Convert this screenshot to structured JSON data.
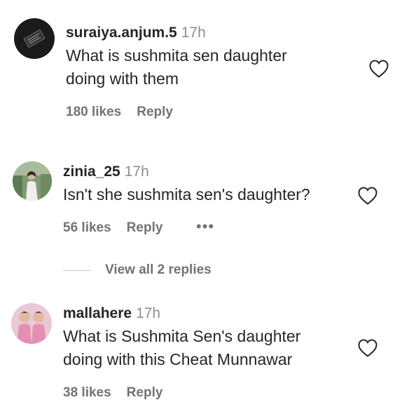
{
  "comments": [
    {
      "username": "suraiya.anjum.5",
      "time": "17h",
      "text_lines": [
        "What is sushmita sen daughter",
        "doing with them"
      ],
      "likes": "180 likes",
      "reply": "Reply",
      "avatar_icon": "dark-tile-avatar"
    },
    {
      "username": "zinia_25",
      "time": "17h",
      "text_lines": [
        "Isn't she sushmita sen's daughter?"
      ],
      "likes": "56 likes",
      "reply": "Reply",
      "more": "•••",
      "avatar_icon": "person-photo-avatar"
    },
    {
      "username": "mallahere",
      "time": "17h",
      "text_lines": [
        "What is Sushmita Sen's daughter",
        "doing with this Cheat Munnawar"
      ],
      "likes": "38 likes",
      "reply": "Reply",
      "avatar_icon": "two-girls-photo-avatar"
    }
  ],
  "view_replies": "View all 2 replies",
  "colors": {
    "text": "#262626",
    "secondary": "#737373",
    "timestamp": "#8e8e8e",
    "divider": "#c7c7c7"
  }
}
